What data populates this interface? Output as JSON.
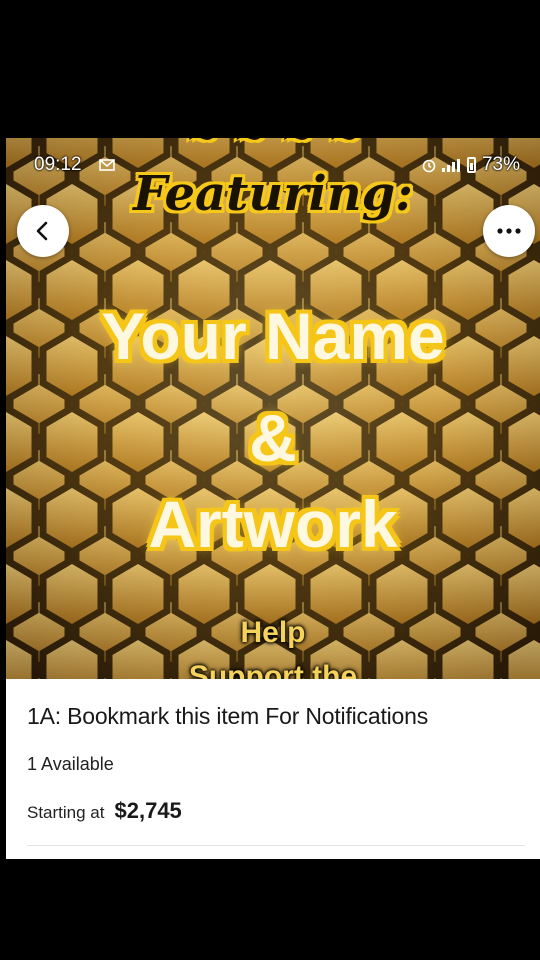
{
  "status_bar": {
    "time": "09:12",
    "battery_percent": "73%"
  },
  "hero": {
    "featuring": "Featuring:",
    "line_name": "Your Name",
    "line_amp": "&",
    "line_artwork": "Artwork",
    "line_help": "Help",
    "line_support": "Support the"
  },
  "listing": {
    "title": "1A: Bookmark this item For Notifications",
    "availability": "1 Available",
    "starting_label": "Starting at",
    "price": "$2,745"
  },
  "icons": {
    "back": "chevron-left-icon",
    "more": "more-horizontal-icon"
  },
  "colors": {
    "gold": "#f5c518",
    "honey_dark": "#1a1205",
    "price_text": "#191919"
  }
}
